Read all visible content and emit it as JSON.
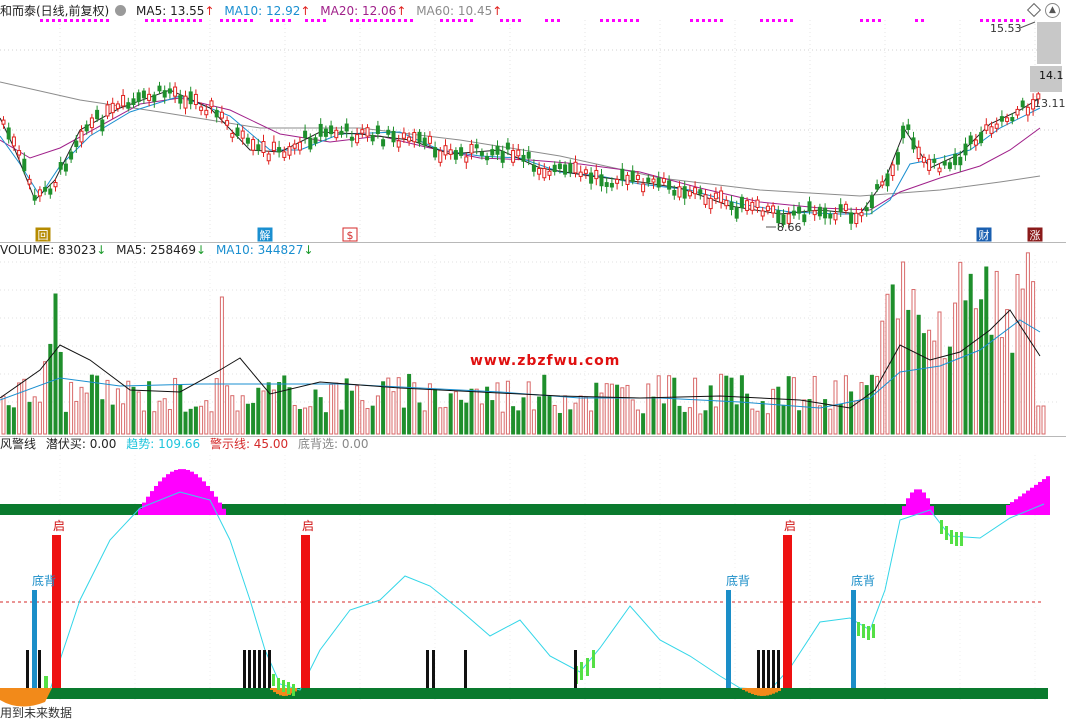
{
  "price_panel": {
    "title": "和而泰(日线,前复权)",
    "ma5_label": "MA5: 13.55",
    "ma5_arrow": "↑",
    "ma10_label": "MA10: 12.92",
    "ma10_arrow": "↑",
    "ma20_label": "MA20: 12.06",
    "ma20_arrow": "↑",
    "ma60_label": "MA60: 10.45",
    "ma60_arrow": "↑",
    "high_label": "15.53",
    "last_label": "14.1",
    "mid_label": "13.11",
    "low_label": "8.66",
    "markers": [
      "回",
      "解",
      "$",
      "财",
      "涨"
    ]
  },
  "volume_panel": {
    "vol_label": "VOLUME: 83023",
    "vol_arrow": "↓",
    "ma5_label": "MA5: 258469",
    "ma5_arrow": "↓",
    "ma10_label": "MA10: 344827",
    "ma10_arrow": "↓",
    "watermark": "www.zbzfwu.com"
  },
  "indicator_panel": {
    "name": "风警线",
    "qianfumai_label": "潜伏买: 0.00",
    "trend_label": "趋势: 109.66",
    "warning_label": "警示线: 45.00",
    "dibeixuan_label": "底背选: 0.00",
    "qi_labels": [
      "启",
      "启",
      "启"
    ],
    "dibei_labels": [
      "底背",
      "底背",
      "底背"
    ],
    "footer_text": "用到未来数据"
  },
  "colors": {
    "up": "#e0221f",
    "down": "#1f8f2c",
    "ma5": "#222222",
    "ma10": "#1a8fd0",
    "ma20": "#a0208a",
    "ma60": "#8c8c8c",
    "magenta": "#ff00ff",
    "trend": "#33d6e8",
    "green_band": "#0a7a2e",
    "warning": "#d42a2a",
    "dibei": "#1b8ec8"
  },
  "chart_data": [
    {
      "type": "line",
      "title": "和而泰(日线,前复权)",
      "series": [
        {
          "name": "MA5",
          "last": 13.55
        },
        {
          "name": "MA10",
          "last": 12.92
        },
        {
          "name": "MA20",
          "last": 12.06
        },
        {
          "name": "MA60",
          "last": 10.45
        }
      ],
      "price_extremes": {
        "high": 15.53,
        "low": 8.66
      }
    },
    {
      "type": "bar",
      "title": "VOLUME",
      "series": [
        {
          "name": "VOLUME",
          "last": 83023
        },
        {
          "name": "MA5",
          "last": 258469
        },
        {
          "name": "MA10",
          "last": 344827
        }
      ]
    },
    {
      "type": "line",
      "title": "风警线",
      "series": [
        {
          "name": "潜伏买",
          "last": 0.0
        },
        {
          "name": "趋势",
          "last": 109.66
        },
        {
          "name": "警示线",
          "last": 45.0
        },
        {
          "name": "底背选",
          "last": 0.0
        }
      ]
    }
  ]
}
